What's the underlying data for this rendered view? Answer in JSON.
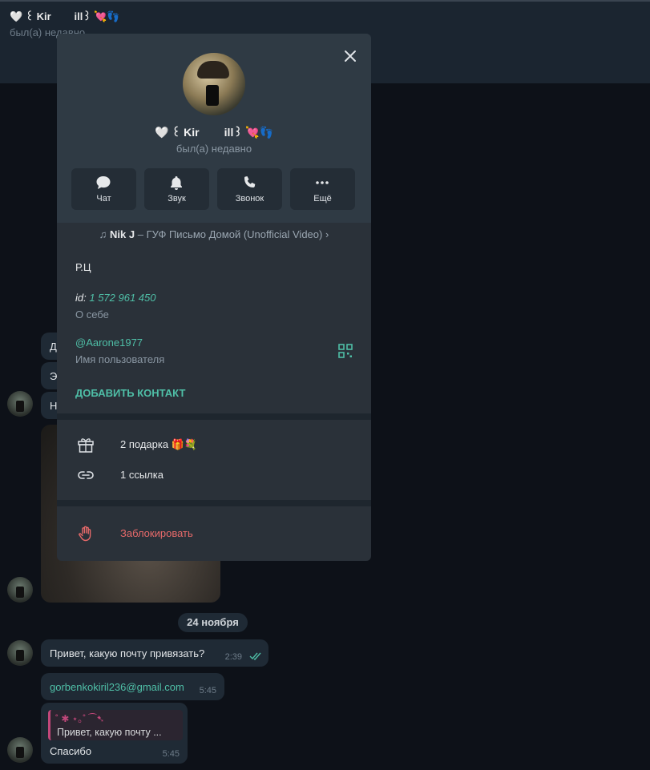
{
  "header": {
    "title": "🤍 ꒰ Kir        ill꒱ 💘👣",
    "status": "был(а) недавно"
  },
  "chat": {
    "partial_text": [
      "Д",
      "Э",
      "Н"
    ],
    "date_pill": "24 ноября",
    "messages": [
      {
        "text": "Привет, какую почту привязать?",
        "time": "2:39"
      },
      {
        "text": "gorbenkokiril236@gmail.com",
        "time": "5:45"
      },
      {
        "reply_preview": "Привет, какую почту ...",
        "reply_deco": "˚ ✱ ⋆｡˚ ⁀➷",
        "text": "Спасибо",
        "time": "5:45"
      }
    ]
  },
  "profile": {
    "name": "🤍 ꒰ Kir        ill꒱ 💘👣",
    "status": "был(а) недавно",
    "actions": [
      {
        "label": "Чат",
        "icon": "chat-icon"
      },
      {
        "label": "Звук",
        "icon": "bell-icon"
      },
      {
        "label": "Звонок",
        "icon": "phone-icon"
      },
      {
        "label": "Ещё",
        "icon": "more-icon"
      }
    ],
    "music": {
      "artist": "Nik J",
      "title": " – ГУФ Письмо Домой (Unofficial Video)",
      "arrow": "›"
    },
    "bio": "Р.Ц",
    "id_label": "id:",
    "id_value": "1 572 961 450",
    "about_label": "О себе",
    "username": "@Aarone1977",
    "username_label": "Имя пользователя",
    "add_contact": "ДОБАВИТЬ КОНТАКТ",
    "gifts": "2 подарка 🎁💐",
    "links": "1 ссылка",
    "block": "Заблокировать"
  },
  "colors": {
    "accent": "#4fbfa7",
    "danger": "#e86a6a",
    "panel": "#2a3139"
  }
}
